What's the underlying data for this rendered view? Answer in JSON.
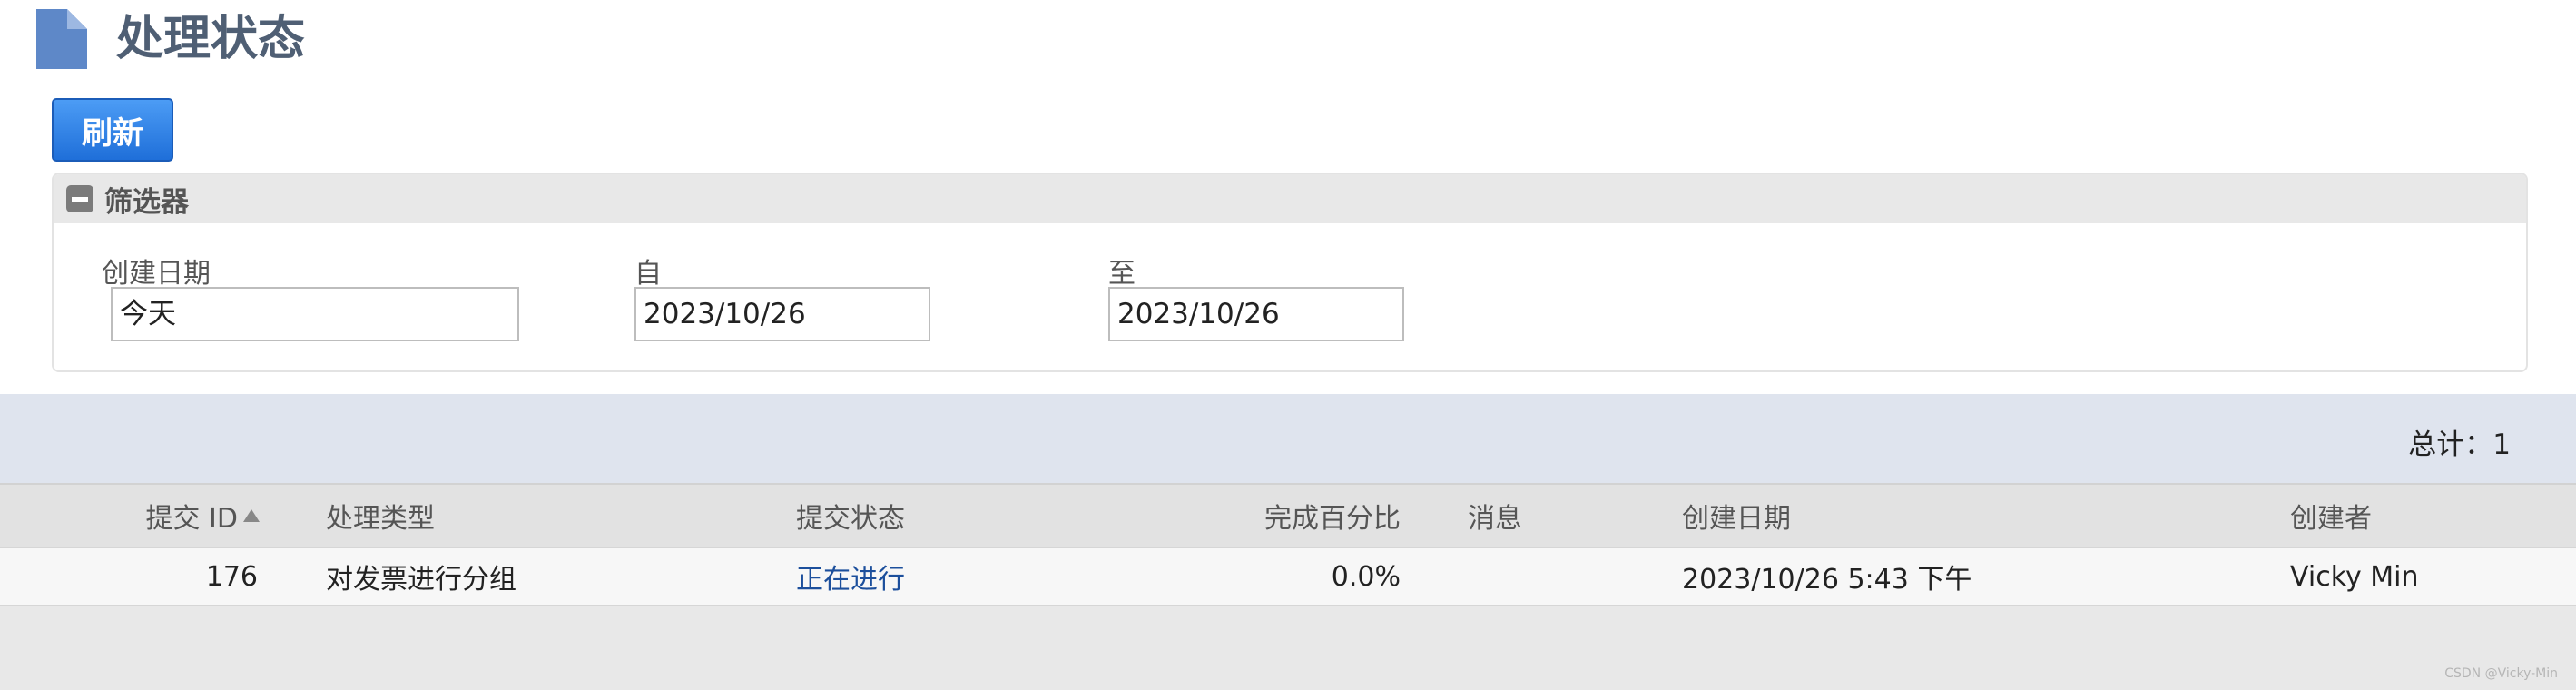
{
  "header": {
    "title": "处理状态",
    "icon": "document-icon",
    "icon_color": "#5e88c8"
  },
  "toolbar": {
    "refresh_label": "刷新",
    "accent_color": "#2a7be4"
  },
  "filter": {
    "title": "筛选器",
    "toggle_icon": "collapse-icon",
    "created_date_label": "创建日期",
    "created_date_value": "今天",
    "from_label": "自",
    "from_value": "2023/10/26",
    "to_label": "至",
    "to_value": "2023/10/26"
  },
  "summary": {
    "total_text": "总计：1"
  },
  "table": {
    "columns": {
      "id": "提交 ID",
      "type": "处理类型",
      "status": "提交状态",
      "percent": "完成百分比",
      "message": "消息",
      "created": "创建日期",
      "creator": "创建者"
    },
    "sort_icon": "sort-asc-icon",
    "rows": [
      {
        "id": "176",
        "type": "对发票进行分组",
        "status": "正在进行",
        "percent": "0.0%",
        "message": "",
        "created": "2023/10/26 5:43 下午",
        "creator": "Vicky Min"
      }
    ]
  },
  "watermark": "CSDN @Vicky-Min"
}
